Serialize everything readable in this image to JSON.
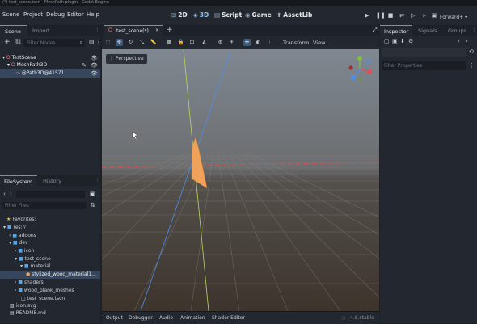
{
  "window": {
    "title": "(*) test_scene.tscn - MeshPath plugin - Godot Engine"
  },
  "menu": {
    "items": [
      "Scene",
      "Project",
      "Debug",
      "Editor",
      "Help"
    ]
  },
  "workspaces": {
    "d2": "2D",
    "d3": "3D",
    "script": "Script",
    "game": "Game",
    "assetlib": "AssetLib"
  },
  "renderer": "Forward+",
  "scene_dock": {
    "tabs": [
      "Scene",
      "Import"
    ],
    "filter_placeholder": "Filter Nodes",
    "nodes": [
      "TestScene",
      "MeshPath3D",
      "@Path3D@41571"
    ]
  },
  "editor_tabs": {
    "current": "test_scene(*)"
  },
  "viewport": {
    "view_menu": "Perspective",
    "toolbar_menus": [
      "Transform",
      "View"
    ],
    "gizmo_icon": "axis-gizmo"
  },
  "filesystem": {
    "tabs": [
      "FileSystem",
      "History"
    ],
    "filter_placeholder": "Filter Files",
    "items": [
      "Favorites:",
      "res://",
      "addons",
      "dev",
      "icon",
      "test_scene",
      "material",
      "stylized_wood_material1...",
      "shaders",
      "wood_plank_meshes",
      "test_scene.tscn",
      "icon.svg",
      "README.md"
    ]
  },
  "inspector": {
    "tabs": [
      "Inspector",
      "Signals",
      "Groups"
    ],
    "filter_placeholder": "Filter Properties"
  },
  "bottom_panel": {
    "tabs": [
      "Output",
      "Debugger",
      "Audio",
      "Animation",
      "Shader Editor"
    ],
    "version": "4.6.stable"
  },
  "colors": {
    "accent": "#4a9fe8",
    "mesh": "#f0a15a",
    "x_axis": "#e05050",
    "y_axis": "#a0d050",
    "z_axis": "#4a8ff0"
  }
}
